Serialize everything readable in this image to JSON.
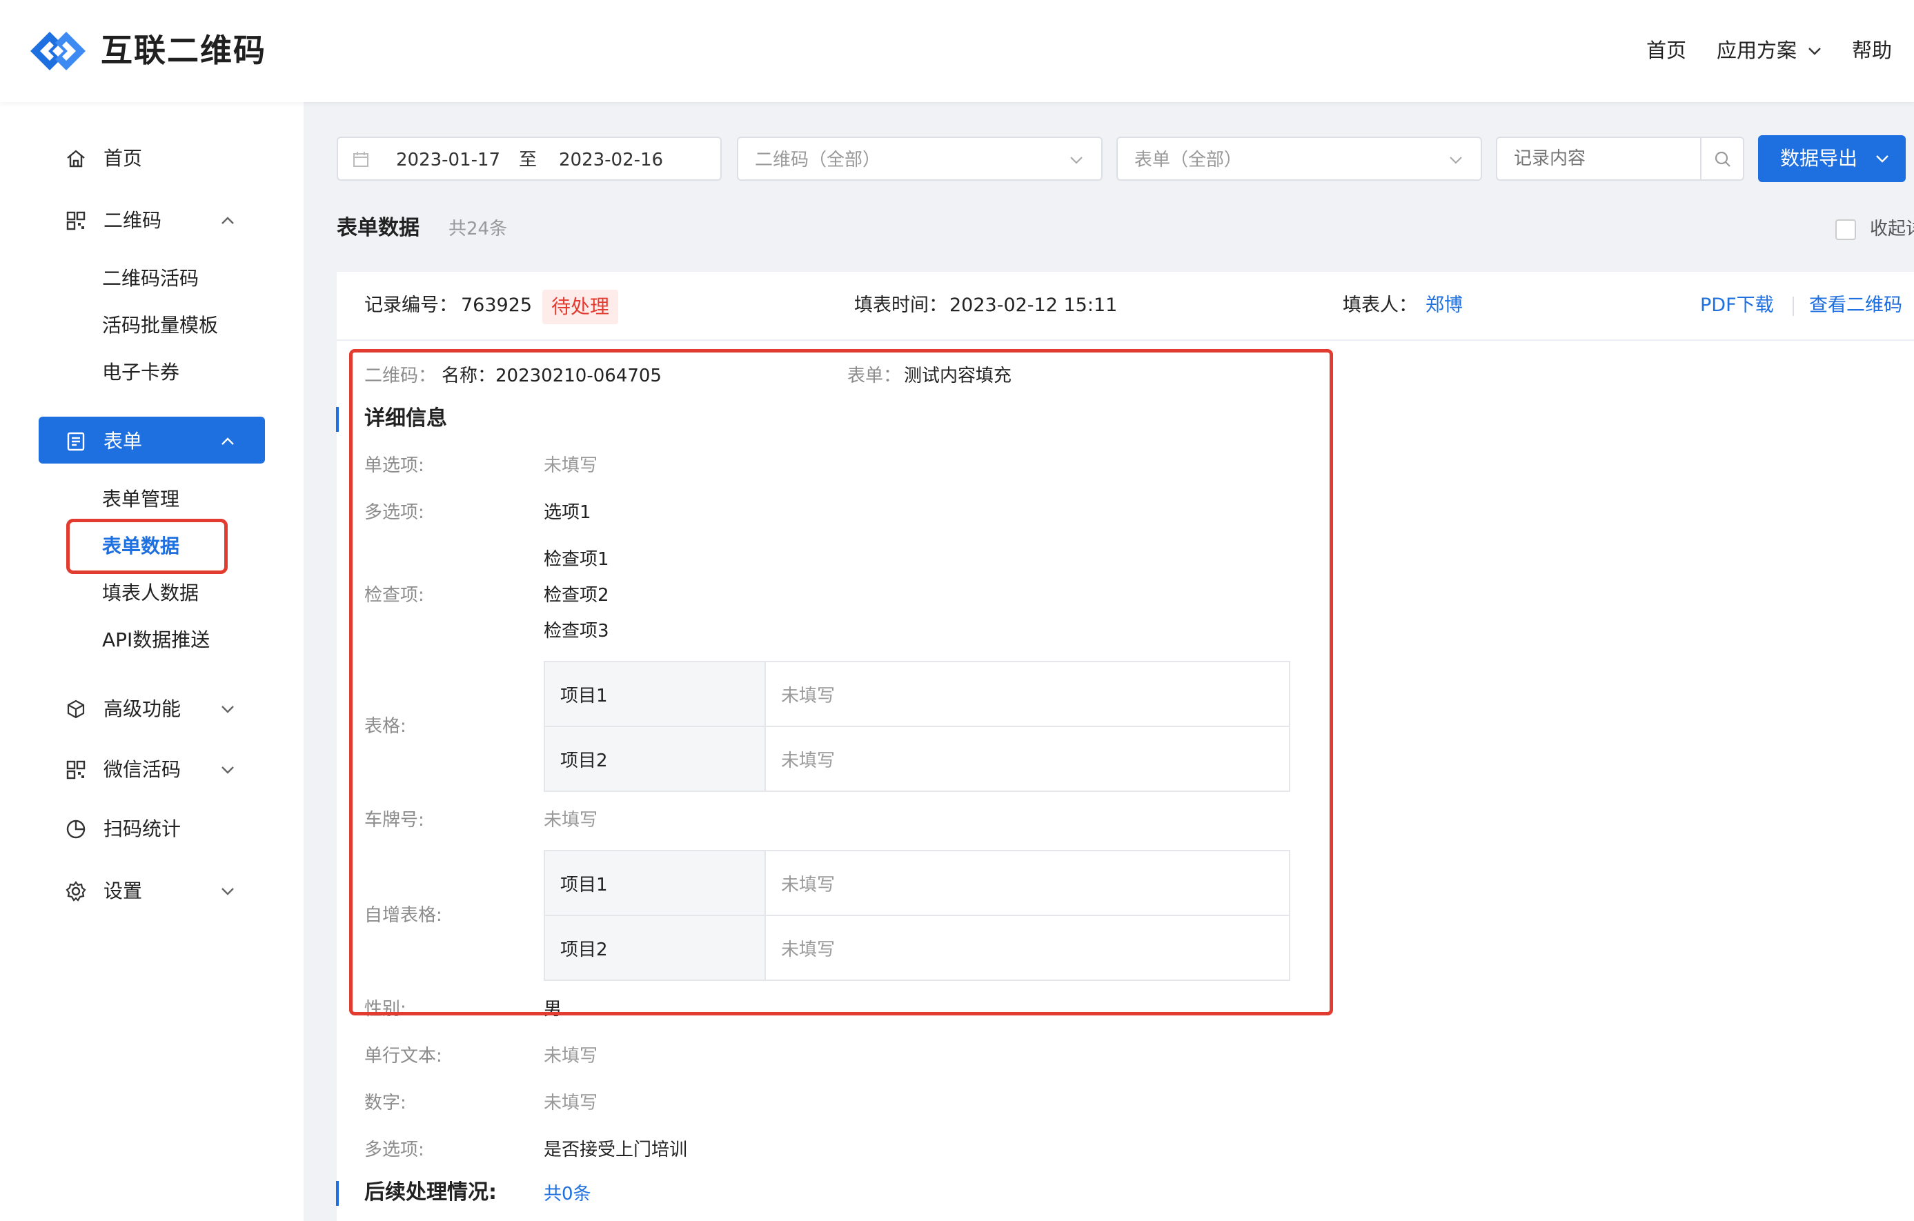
{
  "header": {
    "brand": "互联二维码",
    "nav": {
      "home": "首页",
      "solutions": "应用方案",
      "help": "帮助"
    }
  },
  "sidebar": {
    "home": "首页",
    "qrcode": "二维码",
    "qrcode_children": [
      "二维码活码",
      "活码批量模板",
      "电子卡券"
    ],
    "form": "表单",
    "form_children": [
      "表单管理",
      "表单数据",
      "填表人数据",
      "API数据推送"
    ],
    "advanced": "高级功能",
    "wechat": "微信活码",
    "stats": "扫码统计",
    "settings": "设置"
  },
  "filters": {
    "date_start": "2023-01-17",
    "date_sep": "至",
    "date_end": "2023-02-16",
    "qrcode_placeholder": "二维码（全部）",
    "form_placeholder": "表单（全部）",
    "search_placeholder": "记录内容",
    "export_label": "数据导出"
  },
  "list": {
    "title": "表单数据",
    "count": "共24条",
    "collapse_label": "收起详"
  },
  "record": {
    "id_label": "记录编号：",
    "id": "763925",
    "status": "待处理",
    "time_label": "填表时间：",
    "time": "2023-02-12 15:11",
    "filler_label": "填表人：",
    "filler": "郑博",
    "pdf_link": "PDF下载",
    "view_qr_link": "查看二维码",
    "qr_label": "二维码：",
    "qr_name": "名称：20230210-064705",
    "form_label": "表单：",
    "form_name": "测试内容填充",
    "detail_title": "详细信息",
    "fields": {
      "single_label": "单选项:",
      "single_value": "未填写",
      "multi_label": "多选项:",
      "multi_value": "选项1",
      "check_label": "检查项:",
      "check_values": [
        "检查项1",
        "检查项2",
        "检查项3"
      ],
      "table_label": "表格:",
      "table_rows": [
        {
          "key": "项目1",
          "value": "未填写"
        },
        {
          "key": "项目2",
          "value": "未填写"
        }
      ],
      "plate_label": "车牌号:",
      "plate_value": "未填写",
      "auto_table_label": "自增表格:",
      "auto_table_rows": [
        {
          "key": "项目1",
          "value": "未填写"
        },
        {
          "key": "项目2",
          "value": "未填写"
        }
      ],
      "gender_label": "性别:",
      "gender_value": "男",
      "text_label": "单行文本:",
      "text_value": "未填写",
      "number_label": "数字:",
      "number_value": "未填写",
      "multi2_label": "多选项:",
      "multi2_value": "是否接受上门培训"
    },
    "followup_title": "后续处理情况:",
    "followup_count": "共0条"
  },
  "colors": {
    "accent": "#1e6fe0",
    "highlight": "#e23b30",
    "background": "#f0f2f5"
  }
}
